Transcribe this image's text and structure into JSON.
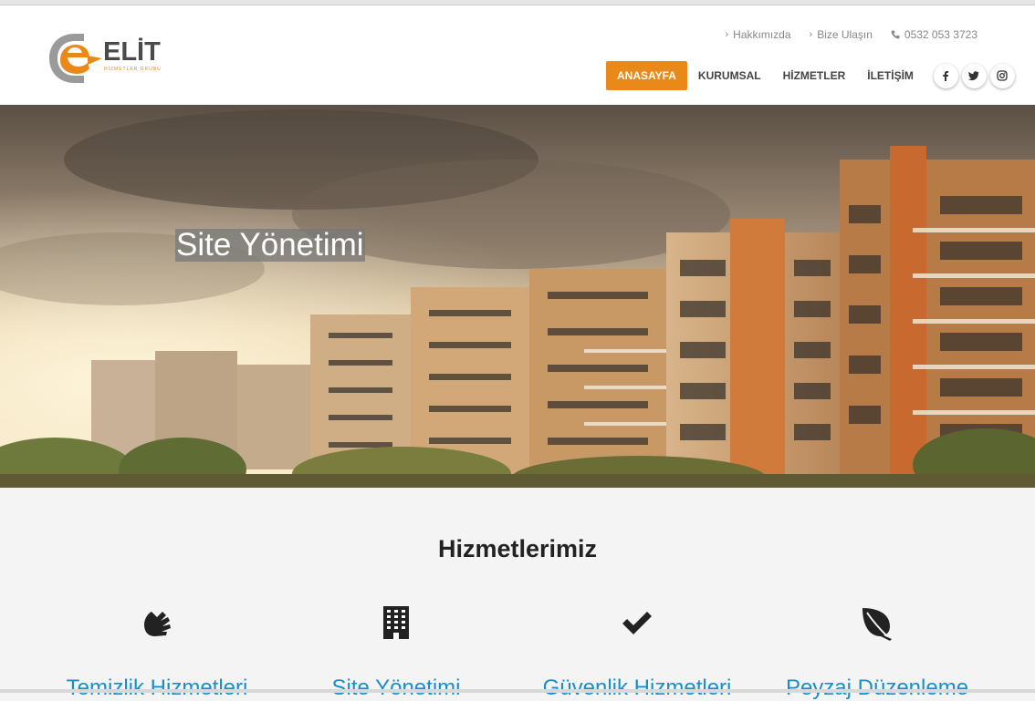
{
  "brand": {
    "name": "ELİT",
    "subtitle": "HİZMETLER GRUBU",
    "accent": "#e8891a"
  },
  "toplinks": [
    {
      "label": "Hakkımızda",
      "icon": "chevron-right-icon"
    },
    {
      "label": "Bize Ulaşın",
      "icon": "chevron-right-icon"
    },
    {
      "label": "0532 053 3723",
      "icon": "phone-icon"
    }
  ],
  "nav": [
    {
      "label": "ANASAYFA",
      "active": true
    },
    {
      "label": "KURUMSAL"
    },
    {
      "label": "HİZMETLER"
    },
    {
      "label": "İLETİŞİM"
    }
  ],
  "socials": [
    {
      "icon": "facebook-icon",
      "glyph": "f"
    },
    {
      "icon": "twitter-icon",
      "glyph": "t"
    },
    {
      "icon": "instagram-icon",
      "glyph": "◎"
    }
  ],
  "hero": {
    "title": "Site Yönetimi"
  },
  "services": {
    "title": "Hizmetlerimiz",
    "items": [
      {
        "label": "Temizlik Hizmetleri",
        "icon": "hands-icon"
      },
      {
        "label": "Site Yönetimi",
        "icon": "building-icon"
      },
      {
        "label": "Güvenlik Hizmetleri",
        "icon": "check-icon"
      },
      {
        "label": "Peyzaj Düzenleme",
        "icon": "leaf-icon"
      }
    ]
  }
}
